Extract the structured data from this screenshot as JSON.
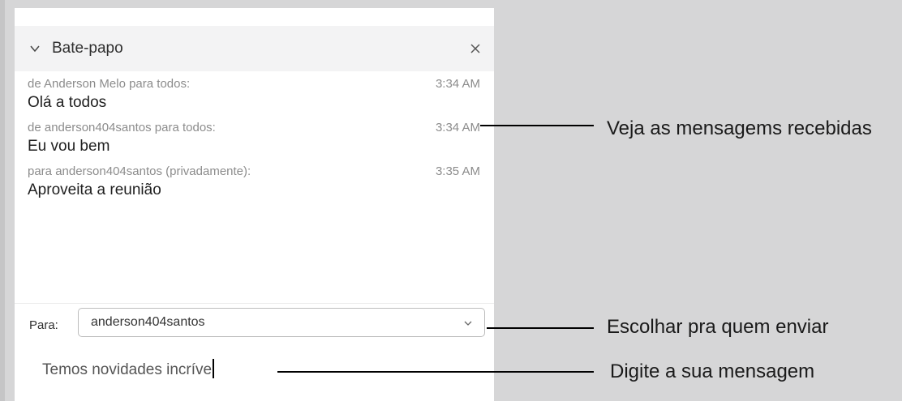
{
  "chat": {
    "title": "Bate-papo",
    "messages": [
      {
        "meta": "de Anderson Melo para todos:",
        "time": "3:34 AM",
        "text": "Olá a todos"
      },
      {
        "meta": "de anderson404santos para todos:",
        "time": "3:34 AM",
        "text": "Eu vou bem"
      },
      {
        "meta": "para anderson404santos (privadamente):",
        "time": "3:35 AM",
        "text": "Aproveita a reunião"
      }
    ],
    "to_label": "Para:",
    "recipient": "anderson404santos",
    "draft": "Temos novidades incríve"
  },
  "callouts": {
    "received": "Veja as mensagems recebidas",
    "recipient": "Escolhar pra quem enviar",
    "type": "Digite a sua mensagem"
  },
  "icons": {
    "collapse": "chevron-down-icon",
    "close": "close-icon",
    "dropdown": "chevron-down-icon"
  }
}
